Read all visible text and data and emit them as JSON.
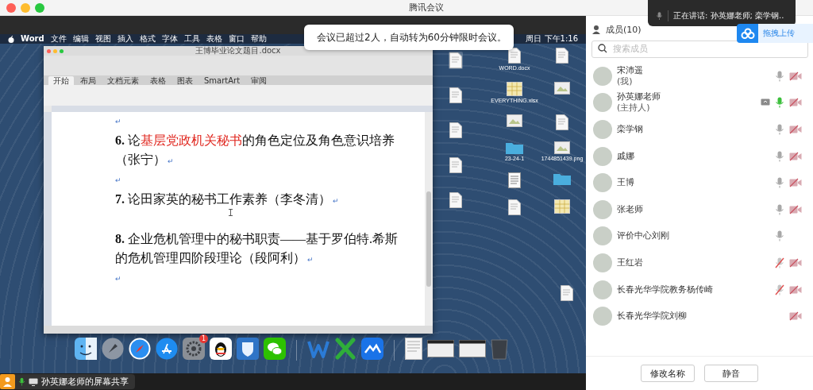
{
  "window": {
    "title": "腾讯会议"
  },
  "notification": {
    "text": "会议已超过2人，自动转为60分钟限时会议。"
  },
  "speaking_popup": {
    "text": "正在讲话:  孙英娜老师; 栾学钢.."
  },
  "upload_widget": {
    "label": "拖拽上传"
  },
  "shared_screen": {
    "menubar": {
      "items": [
        "Word",
        "文件",
        "编辑",
        "视图",
        "插入",
        "格式",
        "字体",
        "工具",
        "表格",
        "窗口",
        "帮助"
      ],
      "clock": "周日 下午1:16"
    },
    "word_window": {
      "title": "王博毕业论文题目.docx",
      "tabs": [
        {
          "label": "开始",
          "selected": true
        },
        {
          "label": "布局",
          "selected": false
        },
        {
          "label": "文档元素",
          "selected": false
        },
        {
          "label": "表格",
          "selected": false
        },
        {
          "label": "图表",
          "selected": false
        },
        {
          "label": "SmartArt",
          "selected": false
        },
        {
          "label": "审阅",
          "selected": false
        }
      ],
      "paragraphs": [
        {
          "kind": "mark",
          "end_mark": "↵"
        },
        {
          "kind": "text",
          "runs": [
            {
              "text": "6.",
              "bold": true
            },
            {
              "text": "  论",
              "bold": false
            },
            {
              "text": "基层党政机关秘书",
              "bold": false,
              "color": "#e0261e"
            },
            {
              "text": "的角色定位及角色意识培养（张宁）",
              "bold": false
            }
          ],
          "end_mark": "↵"
        },
        {
          "kind": "mark",
          "end_mark": "↵"
        },
        {
          "kind": "text",
          "runs": [
            {
              "text": "7.",
              "bold": true
            },
            {
              "text": " 论田家英的秘书工作素养（李冬清）",
              "bold": false
            }
          ],
          "end_mark": "↵"
        },
        {
          "kind": "blank"
        },
        {
          "kind": "text",
          "runs": [
            {
              "text": "8.",
              "bold": true
            },
            {
              "text": " 企业危机管理中的秘书职责——基于罗伯特.希斯的危机管理四阶段理论（段阿利）",
              "bold": false
            }
          ],
          "end_mark": "↵"
        },
        {
          "kind": "mark",
          "end_mark": "↵"
        }
      ]
    },
    "desktop_icons": {
      "left_column": [
        {
          "kind": "doc",
          "selected": true
        },
        {
          "kind": "doc",
          "selected": false
        },
        {
          "kind": "doc",
          "selected": false
        },
        {
          "kind": "doc",
          "selected": false
        },
        {
          "kind": "doc",
          "selected": false
        }
      ],
      "right_grid": [
        {
          "kind": "doc",
          "label": "WORD.docx",
          "selected": false
        },
        {
          "kind": "doc",
          "selected": false
        },
        {
          "kind": "sheet",
          "label": "EVERYTHING.xlsx",
          "selected": false
        },
        {
          "kind": "image",
          "selected": false
        },
        {
          "kind": "image",
          "selected": false
        },
        {
          "kind": "doc",
          "selected": false
        },
        {
          "kind": "folder",
          "label": "23-24-1",
          "selected": false
        },
        {
          "kind": "image",
          "label": "1744851439.png",
          "selected": false
        },
        {
          "kind": "pdf",
          "selected": false
        },
        {
          "kind": "folder",
          "selected": false
        },
        {
          "kind": "doc",
          "selected": false
        },
        {
          "kind": "sheet",
          "selected": false
        }
      ],
      "corner": {
        "kind": "doc",
        "selected": false
      }
    },
    "dock": [
      {
        "kind": "finder"
      },
      {
        "kind": "launchpad"
      },
      {
        "kind": "safari"
      },
      {
        "kind": "appstore"
      },
      {
        "kind": "settings",
        "badge": "1"
      },
      {
        "kind": "penguin"
      },
      {
        "kind": "shield"
      },
      {
        "kind": "chat"
      },
      {
        "kind": "divider"
      },
      {
        "kind": "w"
      },
      {
        "kind": "x"
      },
      {
        "kind": "meeting"
      },
      {
        "kind": "divider"
      },
      {
        "kind": "document"
      },
      {
        "kind": "window"
      },
      {
        "kind": "window"
      },
      {
        "kind": "trash"
      }
    ],
    "share_label": "孙英娜老师的屏幕共享"
  },
  "members_panel": {
    "title": "成员(10)",
    "search": {
      "placeholder": "搜索成员"
    },
    "members": [
      {
        "name": "宋沛遥",
        "role": "(我)",
        "mic": true,
        "muted": false,
        "speaking": false,
        "video_off": true,
        "sharing": false
      },
      {
        "name": "孙英娜老师",
        "role": "(主持人)",
        "mic": true,
        "muted": false,
        "speaking": true,
        "video_off": true,
        "sharing": true
      },
      {
        "name": "栾学钢",
        "mic": true,
        "muted": false,
        "speaking": false,
        "video_off": true,
        "sharing": false
      },
      {
        "name": "戚娜",
        "mic": true,
        "muted": false,
        "speaking": false,
        "video_off": true,
        "sharing": false
      },
      {
        "name": "王博",
        "mic": true,
        "muted": false,
        "speaking": false,
        "video_off": true,
        "sharing": false
      },
      {
        "name": "张老师",
        "mic": true,
        "muted": false,
        "speaking": false,
        "video_off": true,
        "sharing": false
      },
      {
        "name": "评价中心刘刚",
        "mic": true,
        "muted": false,
        "speaking": false,
        "video_off": false,
        "sharing": false
      },
      {
        "name": "王红岩",
        "mic": true,
        "muted": true,
        "speaking": false,
        "video_off": true,
        "sharing": false
      },
      {
        "name": "长春光华学院教务杨传崎",
        "mic": true,
        "muted": true,
        "speaking": false,
        "video_off": true,
        "sharing": false
      },
      {
        "name": "长春光华学院刘柳",
        "mic": false,
        "video_off": true,
        "sharing": false
      }
    ],
    "buttons": [
      "修改名称",
      "静音"
    ]
  }
}
